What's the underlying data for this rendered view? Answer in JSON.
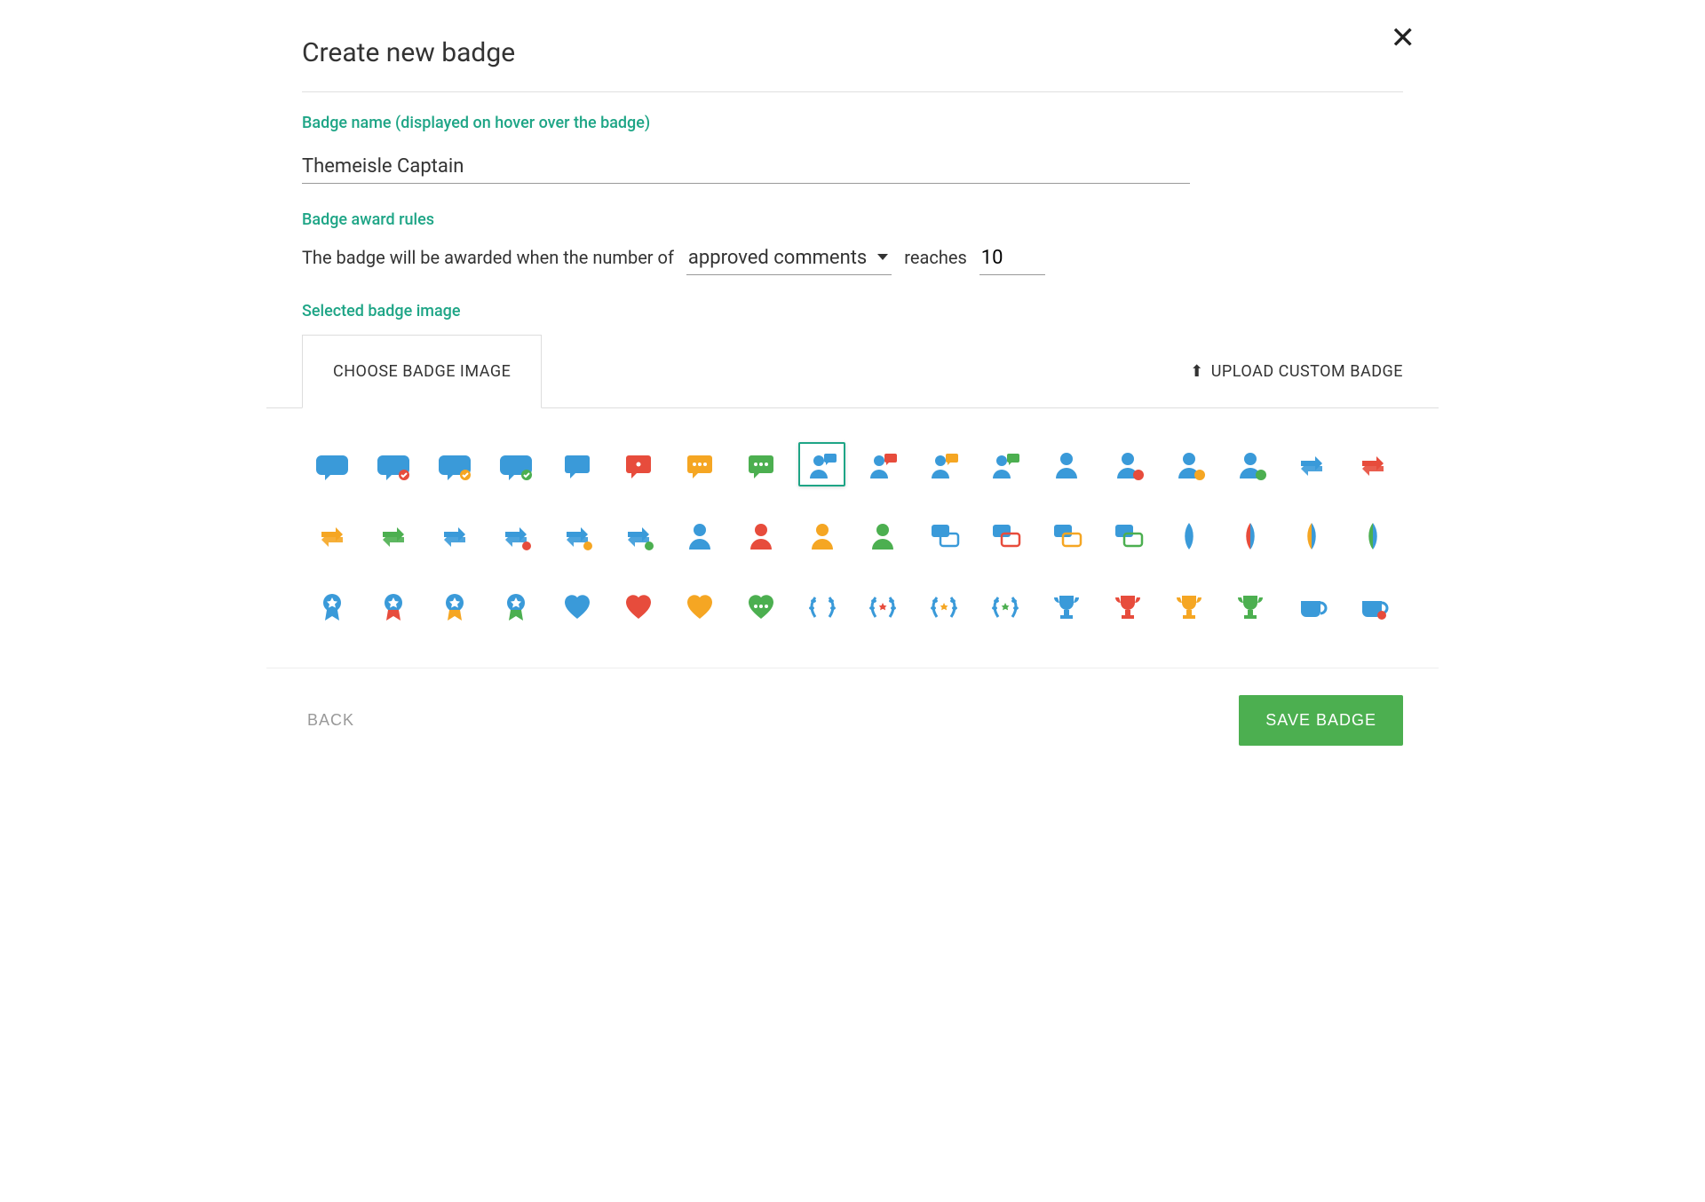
{
  "title": "Create new badge",
  "close_glyph": "✕",
  "labels": {
    "badge_name": "Badge name (displayed on hover over the badge)",
    "award_rules": "Badge award rules",
    "selected_image": "Selected badge image"
  },
  "form": {
    "badge_name_value": "Themeisle Captain",
    "rule_prefix": "The badge will be awarded when the number of",
    "rule_metric_selected": "approved comments",
    "rule_reaches": "reaches",
    "rule_threshold": "10"
  },
  "tabs": {
    "choose": "CHOOSE BADGE IMAGE",
    "upload": "UPLOAD CUSTOM BADGE"
  },
  "footer": {
    "back": "BACK",
    "save": "SAVE BADGE"
  },
  "colors": {
    "blue": "#3a9ad9",
    "red": "#e74c3c",
    "orange": "#f5a623",
    "green": "#4caf50",
    "teal": "#1ea586"
  },
  "selected_badge_index": 8,
  "badges": [
    {
      "name": "speech-bubble",
      "c": "blue"
    },
    {
      "name": "speech-bubble-x",
      "c": "blue",
      "dot": "red"
    },
    {
      "name": "speech-bubble-check-o",
      "c": "blue",
      "dot": "orange"
    },
    {
      "name": "speech-bubble-check-g",
      "c": "blue",
      "dot": "green"
    },
    {
      "name": "speech-square",
      "c": "blue"
    },
    {
      "name": "speech-square-dot",
      "c": "red"
    },
    {
      "name": "speech-square-dots-o",
      "c": "orange"
    },
    {
      "name": "speech-square-dots-g",
      "c": "green"
    },
    {
      "name": "user-chat-blue",
      "c": "blue"
    },
    {
      "name": "user-chat-red",
      "c": "blue",
      "accent": "red"
    },
    {
      "name": "user-chat-orange",
      "c": "blue",
      "accent": "orange"
    },
    {
      "name": "user-chat-green",
      "c": "blue",
      "accent": "green"
    },
    {
      "name": "user-blue",
      "c": "blue"
    },
    {
      "name": "user-x-red",
      "c": "blue",
      "dot": "red"
    },
    {
      "name": "user-clock-o",
      "c": "blue",
      "dot": "orange"
    },
    {
      "name": "user-check-g",
      "c": "blue",
      "dot": "green"
    },
    {
      "name": "arrows-swap-blue",
      "c": "blue"
    },
    {
      "name": "arrows-swap-red",
      "c": "red"
    },
    {
      "name": "arrows-swap-orange",
      "c": "orange"
    },
    {
      "name": "arrows-swap-green",
      "c": "green"
    },
    {
      "name": "arrows-swap-b2",
      "c": "blue"
    },
    {
      "name": "arrows-swap-dot-r",
      "c": "blue",
      "dot": "red"
    },
    {
      "name": "arrows-swap-dot-o",
      "c": "blue",
      "dot": "orange"
    },
    {
      "name": "arrows-swap-dot-g",
      "c": "blue",
      "dot": "green"
    },
    {
      "name": "users-cycle-b",
      "c": "blue"
    },
    {
      "name": "users-cycle-r",
      "c": "red"
    },
    {
      "name": "users-cycle-o",
      "c": "orange"
    },
    {
      "name": "users-cycle-g",
      "c": "green"
    },
    {
      "name": "chats-blue",
      "c": "blue"
    },
    {
      "name": "chats-red-outline",
      "c": "blue",
      "accent": "red"
    },
    {
      "name": "chats-orange-outline",
      "c": "blue",
      "accent": "orange"
    },
    {
      "name": "chats-green-outline",
      "c": "blue",
      "accent": "green"
    },
    {
      "name": "leaf-blue",
      "c": "blue"
    },
    {
      "name": "leaf-red",
      "c": "blue",
      "accent": "red"
    },
    {
      "name": "leaf-orange",
      "c": "blue",
      "accent": "orange"
    },
    {
      "name": "leaf-green",
      "c": "blue",
      "accent": "green"
    },
    {
      "name": "ribbon-star-b",
      "c": "blue"
    },
    {
      "name": "ribbon-star-r",
      "c": "blue",
      "accent": "red"
    },
    {
      "name": "ribbon-star-o",
      "c": "blue",
      "accent": "orange"
    },
    {
      "name": "ribbon-star-g",
      "c": "blue",
      "accent": "green"
    },
    {
      "name": "heart-blue",
      "c": "blue"
    },
    {
      "name": "heart-red",
      "c": "red"
    },
    {
      "name": "heart-orange",
      "c": "orange"
    },
    {
      "name": "heart-green-dots",
      "c": "green"
    },
    {
      "name": "laurel-blue",
      "c": "blue"
    },
    {
      "name": "laurel-star-1",
      "c": "blue",
      "accent": "red"
    },
    {
      "name": "laurel-star-2",
      "c": "blue",
      "accent": "orange"
    },
    {
      "name": "laurel-star-3",
      "c": "blue",
      "accent": "green"
    },
    {
      "name": "trophy-blue",
      "c": "blue"
    },
    {
      "name": "trophy-red",
      "c": "red"
    },
    {
      "name": "trophy-orange",
      "c": "orange"
    },
    {
      "name": "trophy-green",
      "c": "green"
    },
    {
      "name": "mug-blue",
      "c": "blue"
    },
    {
      "name": "mug-red",
      "c": "blue",
      "accent": "red"
    },
    {
      "name": "mug-orange",
      "c": "blue",
      "accent": "orange"
    },
    {
      "name": "mug-gray",
      "c": "blue"
    },
    {
      "name": "send-circle-b",
      "c": "blue"
    },
    {
      "name": "send-circle-r",
      "c": "red"
    },
    {
      "name": "send-circle-o",
      "c": "orange"
    },
    {
      "name": "send-circle-g",
      "c": "green"
    },
    {
      "name": "bubble-round-b",
      "c": "blue"
    },
    {
      "name": "bubble-round-dot-r",
      "c": "blue",
      "dot": "red"
    },
    {
      "name": "bubble-round-dot-o",
      "c": "blue",
      "dot": "orange"
    },
    {
      "name": "bubble-round-dot-g",
      "c": "blue",
      "dot": "green"
    },
    {
      "name": "ring-user-b",
      "c": "blue"
    },
    {
      "name": "ring-user-b2",
      "c": "blue"
    },
    {
      "name": "ring-user-b3",
      "c": "blue"
    },
    {
      "name": "ring-user-b4",
      "c": "blue"
    },
    {
      "name": "arrow-up-b",
      "c": "blue"
    },
    {
      "name": "arrow-up-b2",
      "c": "blue"
    },
    {
      "name": "arrow-up-b3",
      "c": "blue"
    },
    {
      "name": "arrow-up-b4",
      "c": "blue"
    }
  ]
}
